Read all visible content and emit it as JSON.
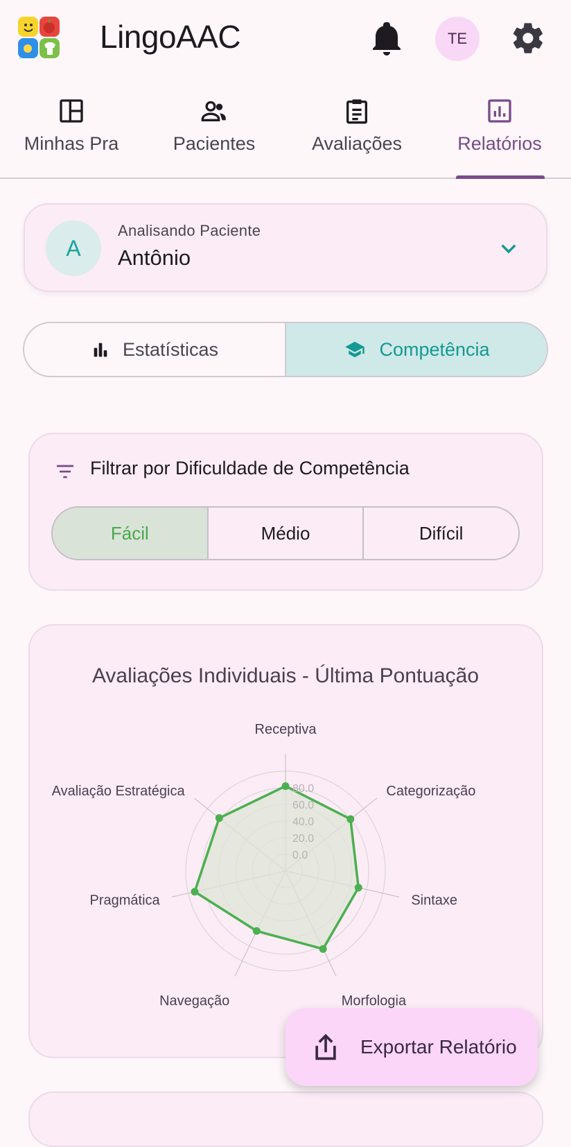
{
  "app": {
    "title": "LingoAAC",
    "user_initials": "TE"
  },
  "tabs": [
    {
      "label": "Minhas Pranchas",
      "icon": "dashboard-icon",
      "visible_label": "Minhas Pra"
    },
    {
      "label": "Pacientes",
      "icon": "people-icon"
    },
    {
      "label": "Avaliações",
      "icon": "clipboard-icon"
    },
    {
      "label": "Relatórios",
      "icon": "bar-chart-icon",
      "active": true
    }
  ],
  "patient": {
    "caption": "Analisando Paciente",
    "name": "Antônio",
    "initial": "A"
  },
  "view_toggle": {
    "stats_label": "Estatísticas",
    "competence_label": "Competência",
    "selected": "Competência"
  },
  "filter": {
    "title": "Filtrar por Dificuldade de Competência",
    "options": [
      "Fácil",
      "Médio",
      "Difícil"
    ],
    "selected": "Fácil"
  },
  "chart_data": {
    "type": "radar",
    "title": "Avaliações Individuais - Última Pontuação",
    "categories": [
      "Receptiva",
      "Categorização",
      "Sintaxe",
      "Morfologia",
      "Navegação",
      "Pragmática",
      "Avaliação Estratégica"
    ],
    "series": [
      {
        "values": [
          82,
          80,
          70,
          84,
          60,
          92,
          82
        ]
      }
    ],
    "radial_ticks": [
      "0.0",
      "20.0",
      "40.0",
      "60.0",
      "80.0"
    ],
    "rlim": [
      -20,
      110
    ],
    "colors": {
      "line": "#4caf50",
      "fill": "#dfe6d7"
    }
  },
  "fab": {
    "label": "Exportar Relatório",
    "icon": "share-icon"
  },
  "colors": {
    "accent": "#7a4a8a",
    "teal": "#139a91",
    "green": "#4caf50"
  }
}
